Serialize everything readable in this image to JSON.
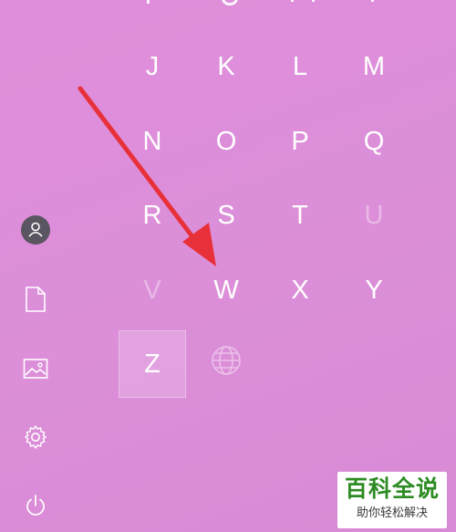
{
  "letter_grid": {
    "rows": [
      [
        {
          "letter": "J",
          "enabled": true
        },
        {
          "letter": "K",
          "enabled": true
        },
        {
          "letter": "L",
          "enabled": true
        },
        {
          "letter": "M",
          "enabled": true
        }
      ],
      [
        {
          "letter": "N",
          "enabled": true
        },
        {
          "letter": "O",
          "enabled": true
        },
        {
          "letter": "P",
          "enabled": true
        },
        {
          "letter": "Q",
          "enabled": true
        }
      ],
      [
        {
          "letter": "R",
          "enabled": true
        },
        {
          "letter": "S",
          "enabled": true
        },
        {
          "letter": "T",
          "enabled": true
        },
        {
          "letter": "U",
          "enabled": false
        }
      ],
      [
        {
          "letter": "V",
          "enabled": false
        },
        {
          "letter": "W",
          "enabled": true
        },
        {
          "letter": "X",
          "enabled": true
        },
        {
          "letter": "Y",
          "enabled": true
        }
      ],
      [
        {
          "letter": "Z",
          "enabled": true,
          "selected": true
        },
        {
          "icon": "globe-icon",
          "enabled": false
        }
      ]
    ]
  },
  "left_rail": {
    "items": [
      {
        "icon": "user-avatar-icon"
      },
      {
        "icon": "document-icon"
      },
      {
        "icon": "pictures-icon"
      },
      {
        "icon": "settings-gear-icon"
      },
      {
        "icon": "power-icon"
      }
    ]
  },
  "annotation": {
    "icon": "red-arrow",
    "color": "#e8303a"
  },
  "watermark": {
    "title": "百科全说",
    "subtitle": "助你轻松解决",
    "title_color": "#2d8b23"
  },
  "colors": {
    "background": "#dc8ed9",
    "text": "#ffffff",
    "accent": "#e8303a"
  }
}
